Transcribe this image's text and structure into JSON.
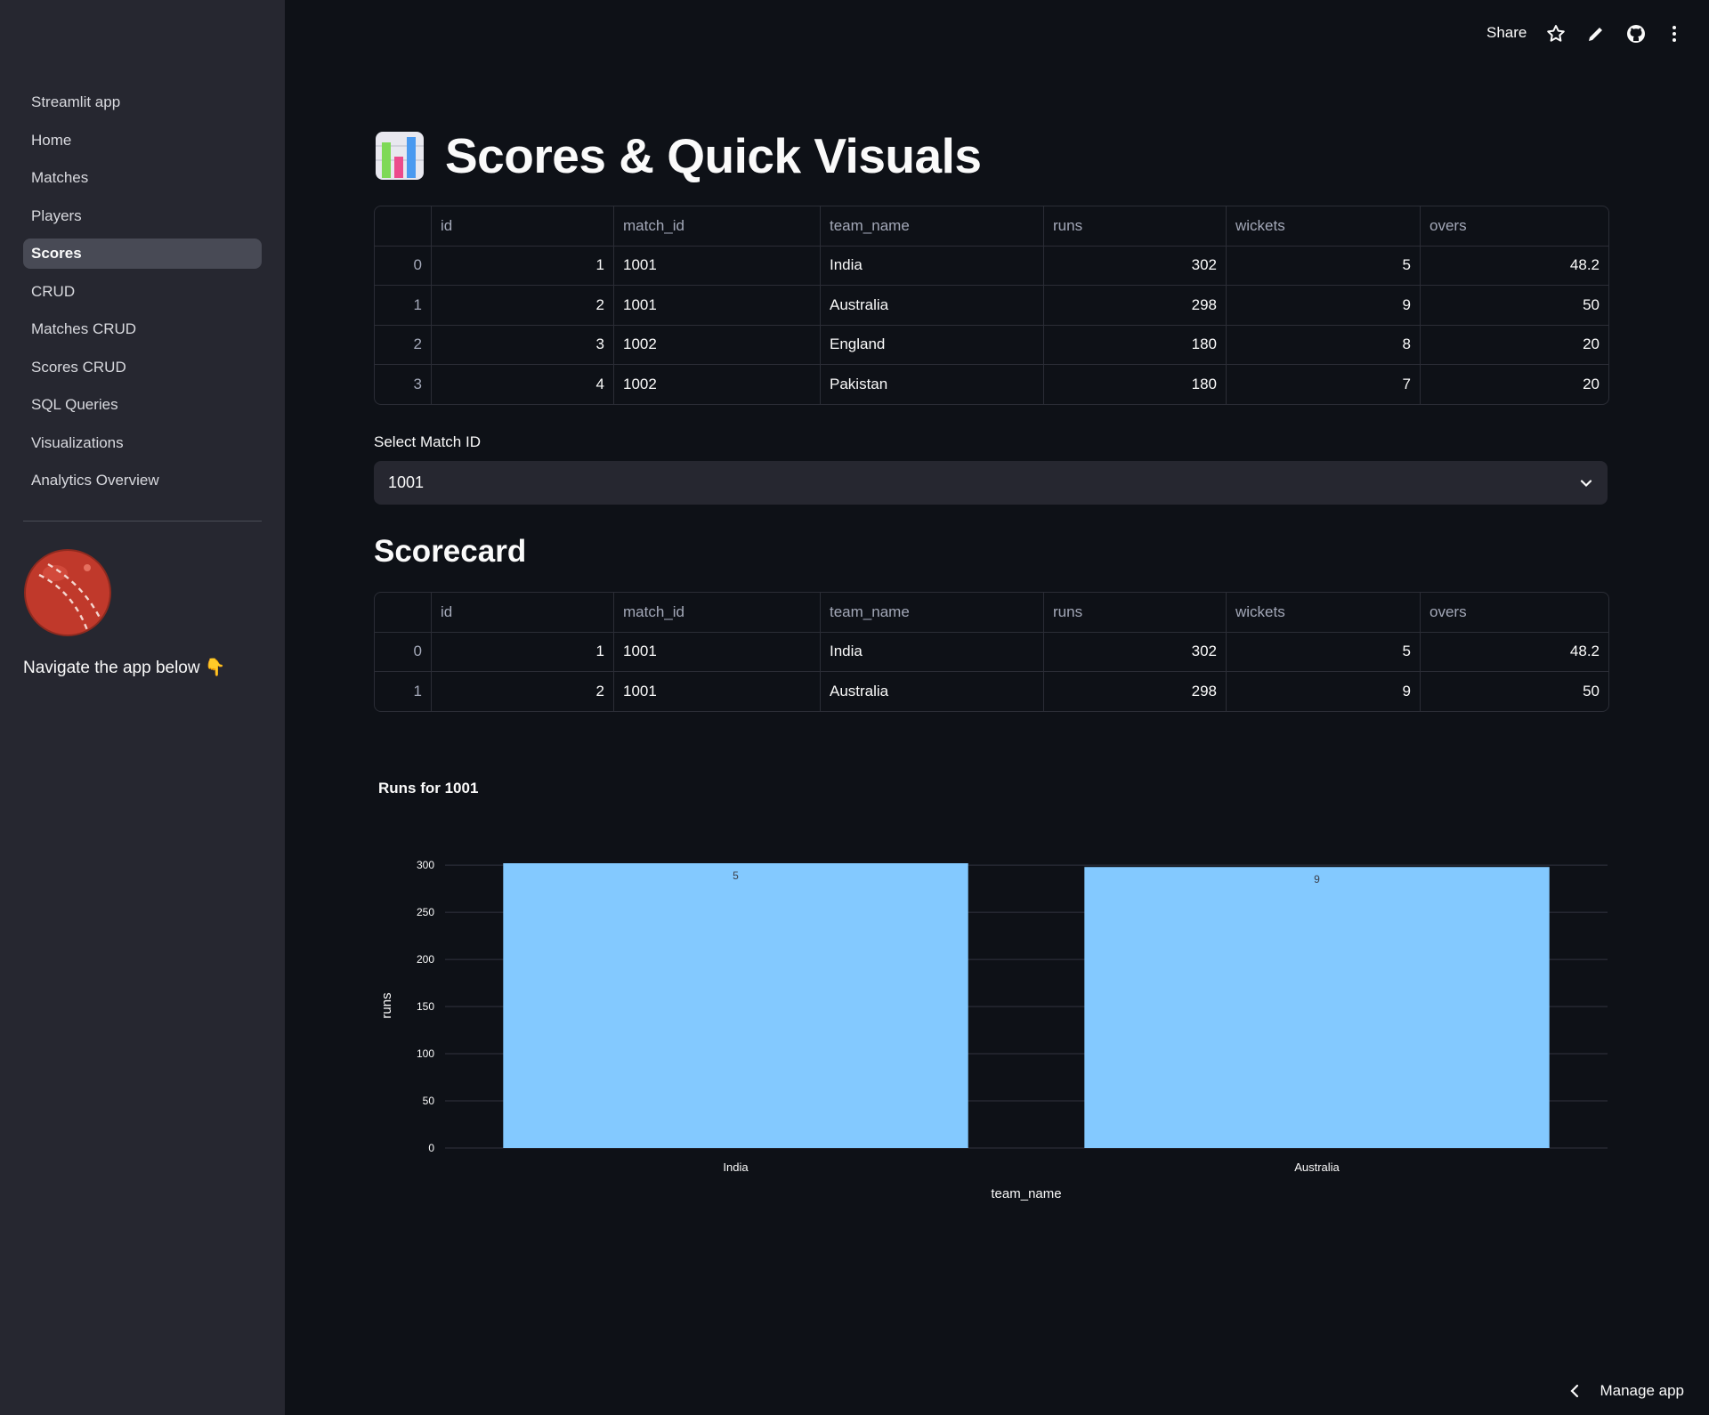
{
  "sidebar": {
    "items": [
      {
        "label": "Streamlit app",
        "active": false
      },
      {
        "label": "Home",
        "active": false
      },
      {
        "label": "Matches",
        "active": false
      },
      {
        "label": "Players",
        "active": false
      },
      {
        "label": "Scores",
        "active": true
      },
      {
        "label": "CRUD",
        "active": false
      },
      {
        "label": "Matches CRUD",
        "active": false
      },
      {
        "label": "Scores CRUD",
        "active": false
      },
      {
        "label": "SQL Queries",
        "active": false
      },
      {
        "label": "Visualizations",
        "active": false
      },
      {
        "label": "Analytics Overview",
        "active": false
      }
    ],
    "caption": "Navigate the app below 👇",
    "image_icon": "cricket-ball-icon"
  },
  "header": {
    "share_label": "Share",
    "icons": [
      "star-icon",
      "pencil-icon",
      "github-icon",
      "more-vertical-icon"
    ]
  },
  "main": {
    "title": "Scores & Quick Visuals",
    "title_icon": "bar-chart-icon",
    "table_columns": [
      "",
      "id",
      "match_id",
      "team_name",
      "runs",
      "wickets",
      "overs"
    ],
    "scores_table": [
      [
        "0",
        "1",
        "1001",
        "India",
        "302",
        "5",
        "48.2"
      ],
      [
        "1",
        "2",
        "1001",
        "Australia",
        "298",
        "9",
        "50"
      ],
      [
        "2",
        "3",
        "1002",
        "England",
        "180",
        "8",
        "20"
      ],
      [
        "3",
        "4",
        "1002",
        "Pakistan",
        "180",
        "7",
        "20"
      ]
    ],
    "select_label": "Select Match ID",
    "select_value": "1001",
    "scorecard_title": "Scorecard",
    "scorecard_table": [
      [
        "0",
        "1",
        "1001",
        "India",
        "302",
        "5",
        "48.2"
      ],
      [
        "1",
        "2",
        "1001",
        "Australia",
        "298",
        "9",
        "50"
      ]
    ]
  },
  "chart_data": {
    "type": "bar",
    "title": "Runs for 1001",
    "categories": [
      "India",
      "Australia"
    ],
    "values": [
      302,
      298
    ],
    "bar_text": [
      "5",
      "9"
    ],
    "xlabel": "team_name",
    "ylabel": "runs",
    "ylim": [
      0,
      302
    ],
    "yticks": [
      0,
      50,
      100,
      150,
      200,
      250,
      300
    ],
    "bar_color": "#83c9ff",
    "grid": true
  },
  "footer": {
    "manage_label": "Manage app"
  },
  "colors": {
    "background": "#0e1117",
    "sidebar": "#262730",
    "bar": "#83c9ff"
  }
}
